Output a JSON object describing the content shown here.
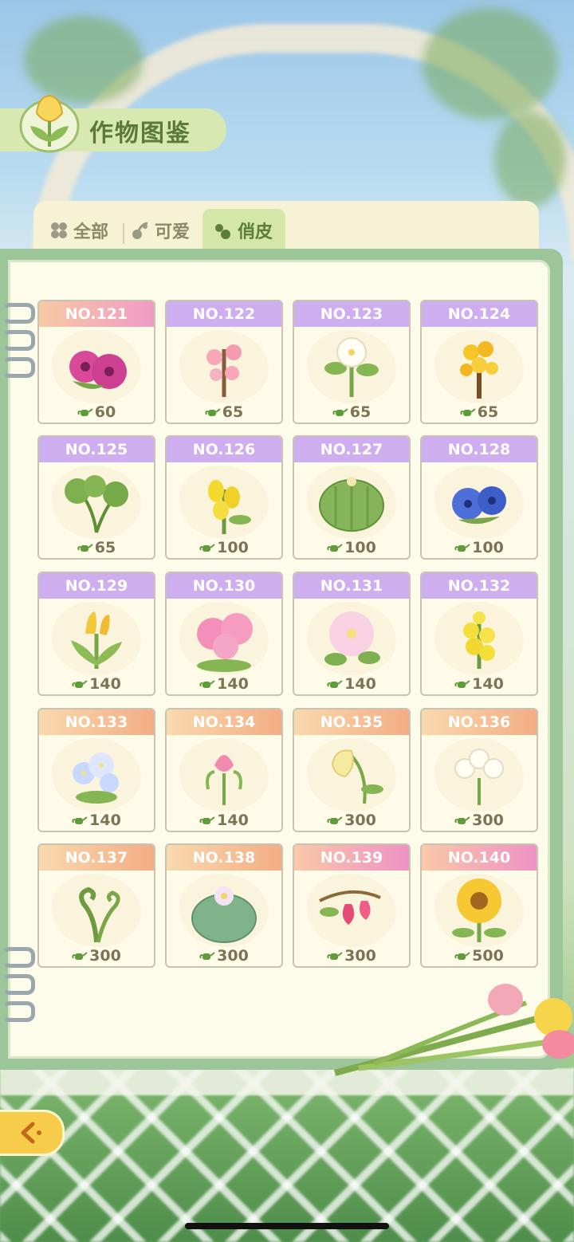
{
  "header": {
    "title": "作物图鉴"
  },
  "tabs": [
    {
      "label": "全部",
      "icon": "clover-icon",
      "active": false
    },
    {
      "label": "可爱",
      "icon": "cherry-icon",
      "active": false
    },
    {
      "label": "俏皮",
      "icon": "notes-icon",
      "active": true
    }
  ],
  "cards": [
    {
      "no": "NO.121",
      "price": "60",
      "header_style": "pink",
      "flower": "petunia-magenta"
    },
    {
      "no": "NO.122",
      "price": "65",
      "header_style": "purple",
      "flower": "peach-blossom"
    },
    {
      "no": "NO.123",
      "price": "65",
      "header_style": "purple",
      "flower": "white-jasmine"
    },
    {
      "no": "NO.124",
      "price": "65",
      "header_style": "purple",
      "flower": "osmanthus"
    },
    {
      "no": "NO.125",
      "price": "65",
      "header_style": "purple",
      "flower": "fern-leaf"
    },
    {
      "no": "NO.126",
      "price": "100",
      "header_style": "purple",
      "flower": "yellow-orchid"
    },
    {
      "no": "NO.127",
      "price": "100",
      "header_style": "purple",
      "flower": "barrel-cactus"
    },
    {
      "no": "NO.128",
      "price": "100",
      "header_style": "purple",
      "flower": "blue-morning-glory"
    },
    {
      "no": "NO.129",
      "price": "140",
      "header_style": "purple",
      "flower": "yellow-tulip"
    },
    {
      "no": "NO.130",
      "price": "140",
      "header_style": "purple",
      "flower": "pink-lily"
    },
    {
      "no": "NO.131",
      "price": "140",
      "header_style": "purple",
      "flower": "pink-primrose"
    },
    {
      "no": "NO.132",
      "price": "140",
      "header_style": "purple",
      "flower": "snapdragon"
    },
    {
      "no": "NO.133",
      "price": "140",
      "header_style": "orange",
      "flower": "forget-me-not"
    },
    {
      "no": "NO.134",
      "price": "140",
      "header_style": "orange",
      "flower": "pink-iris"
    },
    {
      "no": "NO.135",
      "price": "300",
      "header_style": "orange",
      "flower": "bellflower"
    },
    {
      "no": "NO.136",
      "price": "300",
      "header_style": "orange",
      "flower": "white-freesia"
    },
    {
      "no": "NO.137",
      "price": "300",
      "header_style": "orange",
      "flower": "fiddlehead"
    },
    {
      "no": "NO.138",
      "price": "300",
      "header_style": "orange",
      "flower": "flowering-cactus"
    },
    {
      "no": "NO.139",
      "price": "300",
      "header_style": "pink2",
      "flower": "bleeding-heart"
    },
    {
      "no": "NO.140",
      "price": "500",
      "header_style": "pink2",
      "flower": "sunflower"
    }
  ],
  "colors": {
    "accent_green": "#5b7a3a",
    "tab_active": "#d4e7a8",
    "back_button": "#f6cc4a"
  }
}
